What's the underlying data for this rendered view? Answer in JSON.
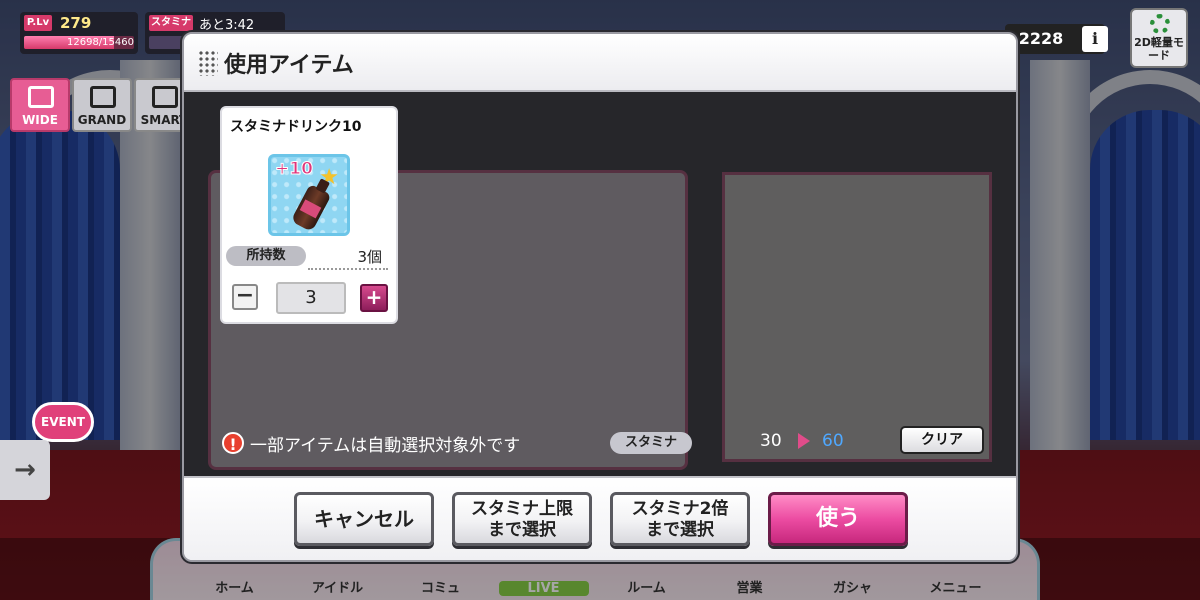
{
  "hud": {
    "plv_tag": "P.Lv",
    "plv_value": "279",
    "plv_exp": "12698/15460",
    "plv_progress": 0.82,
    "stamina_tag": "スタミナ",
    "stamina_timer": "あと3:42"
  },
  "modes": [
    {
      "label": "WIDE",
      "active": true
    },
    {
      "label": "GRAND",
      "active": false
    },
    {
      "label": "SMART",
      "active": false
    }
  ],
  "topright": {
    "money": "2228",
    "info_label": "i",
    "mode2d_label": "2D軽量モード"
  },
  "side": {
    "event_label": "EVENT",
    "arrow_glyph": "→"
  },
  "nav": [
    "ホーム",
    "アイドル",
    "コミュ",
    "LIVE",
    "ルーム",
    "営業",
    "ガシャ",
    "メニュー"
  ],
  "modal": {
    "title": "使用アイテム",
    "item": {
      "name": "スタミナドリンク10",
      "badge": "+10",
      "owned_label": "所持数",
      "owned_count": "3個",
      "quantity": "3",
      "minus": "−",
      "plus": "+"
    },
    "notice": "一部アイテムは自動選択対象外です",
    "stamina": {
      "label": "スタミナ",
      "from": "30",
      "to": "60"
    },
    "clear_label": "クリア",
    "buttons": {
      "cancel": "キャンセル",
      "max_line1": "スタミナ上限",
      "max_line2": "まで選択",
      "double_line1": "スタミナ2倍",
      "double_line2": "まで選択",
      "use": "使う"
    }
  },
  "colors": {
    "accent": "#ec4ca2",
    "stamina_to": "#4fa8ff",
    "alert": "#e8402f"
  }
}
